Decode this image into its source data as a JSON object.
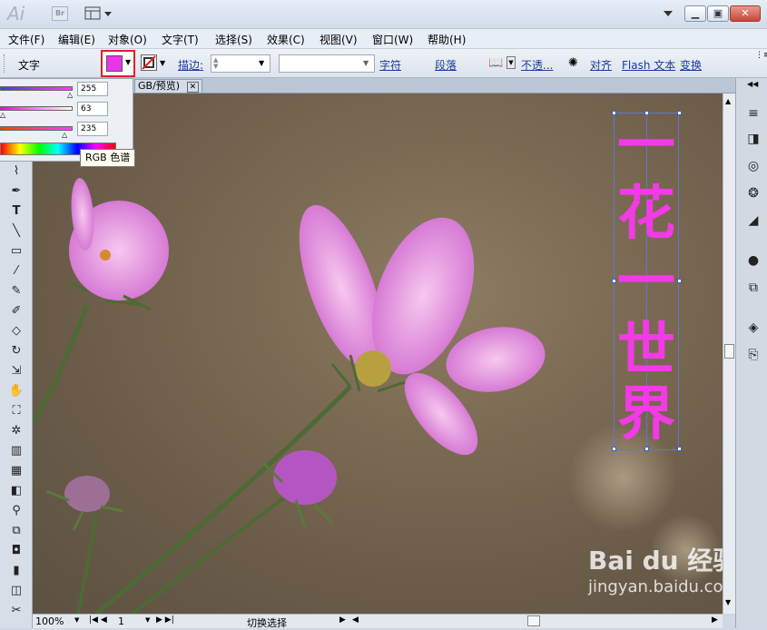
{
  "app": {
    "logo": "Ai",
    "bridge": "Br"
  },
  "menu": [
    "文件(F)",
    "编辑(E)",
    "对象(O)",
    "文字(T)",
    "选择(S)",
    "效果(C)",
    "视图(V)",
    "窗口(W)",
    "帮助(H)"
  ],
  "control": {
    "mode_label": "文字",
    "fill_color": "#e835e8",
    "stroke_label": "描边:",
    "char_label": "字符",
    "para_label": "段落",
    "opacity_label": "不透...",
    "align_label": "对齐",
    "flash_label": "Flash 文本",
    "transform_label": "变换"
  },
  "color_panel": {
    "r": "255",
    "g": "63",
    "b": "235",
    "tooltip": "RGB 色谱"
  },
  "document": {
    "tab_label": "GB/预览)"
  },
  "artwork": {
    "text_chars": [
      "一",
      "花",
      "一",
      "世",
      "界"
    ],
    "text_color": "#f23ae6"
  },
  "status": {
    "zoom": "100%",
    "page": "1",
    "tool": "切换选择"
  },
  "watermark": {
    "brand": "Bai du 经验",
    "url": "jingyan.baidu.com"
  }
}
